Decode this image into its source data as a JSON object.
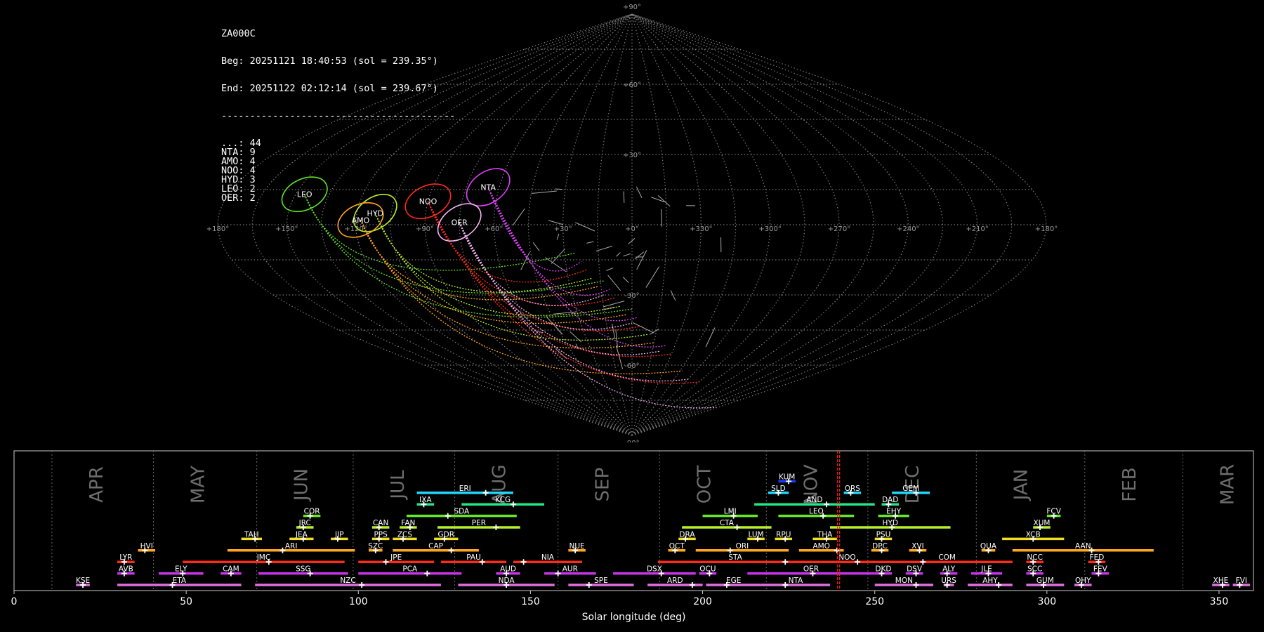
{
  "info": {
    "camera": "ZA000C",
    "beg": "Beg: 20251121 18:40:53 (sol = 239.35°)",
    "end": "End: 20251122 02:12:14 (sol = 239.67°)",
    "separator": "-----------------------------------------",
    "counts": [
      {
        "code": "...",
        "count": 44
      },
      {
        "code": "NTA",
        "count": 9
      },
      {
        "code": "AMO",
        "count": 4
      },
      {
        "code": "NOO",
        "count": 4
      },
      {
        "code": "HYD",
        "count": 3
      },
      {
        "code": "LEO",
        "count": 2
      },
      {
        "code": "OER",
        "count": 2
      }
    ]
  },
  "chart_data": [
    {
      "type": "scatter",
      "projection": "sinusoidal",
      "grid": true,
      "lon_tick_labels": [
        "+180°",
        "+150°",
        "+120°",
        "+90°",
        "+60°",
        "+30°",
        "+0°",
        "+330°",
        "+300°",
        "+270°",
        "+240°",
        "+210°",
        "+180°"
      ],
      "lat_tick_labels": [
        "+90°",
        "+60°",
        "+30°",
        "-30°",
        "-60°",
        "-90°"
      ],
      "radiants": [
        {
          "name": "LEO",
          "lon": 146,
          "lat": 13,
          "color": "#5fe22a"
        },
        {
          "name": "NTA",
          "lon": 65,
          "lat": 16,
          "color": "#e040fb"
        },
        {
          "name": "NOO",
          "lon": 90,
          "lat": 10,
          "color": "#ff2a1a"
        },
        {
          "name": "HYD",
          "lon": 112,
          "lat": 5,
          "color": "#b8f02a"
        },
        {
          "name": "AMO",
          "lon": 118,
          "lat": 2,
          "color": "#ffa520"
        },
        {
          "name": "OER",
          "lon": 75,
          "lat": 1,
          "color": "#f4b4f4"
        }
      ],
      "sporadic_count": 44
    },
    {
      "type": "range",
      "xlabel": "Solar longitude (deg)",
      "xlim": [
        0,
        360
      ],
      "x_ticks": [
        0,
        50,
        100,
        150,
        200,
        250,
        300,
        350
      ],
      "current_sol": 239.5,
      "months": [
        {
          "label": "APR",
          "start": 11
        },
        {
          "label": "MAY",
          "start": 40.5
        },
        {
          "label": "JUN",
          "start": 70.5
        },
        {
          "label": "JUL",
          "start": 98.5
        },
        {
          "label": "AUG",
          "start": 128
        },
        {
          "label": "SEP",
          "start": 158
        },
        {
          "label": "OCT",
          "start": 187.5
        },
        {
          "label": "NOV",
          "start": 218.5
        },
        {
          "label": "DEC",
          "start": 248
        },
        {
          "label": "JAN",
          "start": 279.5
        },
        {
          "label": "FEB",
          "start": 311
        },
        {
          "label": "MAR",
          "start": 339.5
        }
      ],
      "showers": [
        {
          "name": "KUM",
          "start": 222,
          "end": 227,
          "peak": 225,
          "row": 10,
          "color": "#1a3cff"
        },
        {
          "name": "ERI",
          "start": 117,
          "end": 145,
          "peak": 137,
          "row": 9,
          "color": "#22d8ff"
        },
        {
          "name": "SLD",
          "start": 219,
          "end": 225,
          "peak": 222,
          "row": 9,
          "color": "#22d8ff"
        },
        {
          "name": "ORS",
          "start": 241,
          "end": 246,
          "peak": 243,
          "row": 9,
          "color": "#22d8ff"
        },
        {
          "name": "GEM",
          "start": 255,
          "end": 266,
          "peak": 262,
          "row": 9,
          "color": "#22d8ff"
        },
        {
          "name": "IXA",
          "start": 117,
          "end": 122,
          "peak": 119,
          "row": 8,
          "color": "#22e888"
        },
        {
          "name": "KCG",
          "start": 130,
          "end": 154,
          "peak": 145,
          "row": 8,
          "color": "#22e888"
        },
        {
          "name": "AND",
          "start": 215,
          "end": 250,
          "peak": 236,
          "row": 8,
          "color": "#22e888"
        },
        {
          "name": "DAD",
          "start": 252,
          "end": 257,
          "peak": 254,
          "row": 8,
          "color": "#22e888"
        },
        {
          "name": "COR",
          "start": 84,
          "end": 89,
          "peak": 86,
          "row": 7,
          "color": "#66e82a"
        },
        {
          "name": "SDA",
          "start": 114,
          "end": 146,
          "peak": 126,
          "row": 7,
          "color": "#66e82a"
        },
        {
          "name": "LMI",
          "start": 200,
          "end": 216,
          "peak": 209,
          "row": 7,
          "color": "#66e82a"
        },
        {
          "name": "LEO",
          "start": 222,
          "end": 244,
          "peak": 235,
          "row": 7,
          "color": "#66e82a"
        },
        {
          "name": "EHY",
          "start": 251,
          "end": 260,
          "peak": 256,
          "row": 7,
          "color": "#66e82a"
        },
        {
          "name": "FCV",
          "start": 300,
          "end": 304,
          "peak": 302,
          "row": 7,
          "color": "#66e82a"
        },
        {
          "name": "JRC",
          "start": 82,
          "end": 87,
          "peak": 84,
          "row": 6,
          "color": "#b8f02a"
        },
        {
          "name": "CAN",
          "start": 104,
          "end": 109,
          "peak": 106,
          "row": 6,
          "color": "#b8f02a"
        },
        {
          "name": "FAN",
          "start": 112,
          "end": 117,
          "peak": 115,
          "row": 6,
          "color": "#b8f02a"
        },
        {
          "name": "PER",
          "start": 123,
          "end": 147,
          "peak": 140,
          "row": 6,
          "color": "#b8f02a"
        },
        {
          "name": "CTA",
          "start": 194,
          "end": 220,
          "peak": 210,
          "row": 6,
          "color": "#b8f02a"
        },
        {
          "name": "HYD",
          "start": 237,
          "end": 272,
          "peak": 255,
          "row": 6,
          "color": "#b8f02a"
        },
        {
          "name": "XUM",
          "start": 296,
          "end": 301,
          "peak": 298,
          "row": 6,
          "color": "#b8f02a"
        },
        {
          "name": "TAH",
          "start": 66,
          "end": 72,
          "peak": 70,
          "row": 5,
          "color": "#f0e020"
        },
        {
          "name": "JEA",
          "start": 80,
          "end": 87,
          "peak": 84,
          "row": 5,
          "color": "#f0e020"
        },
        {
          "name": "JIP",
          "start": 92,
          "end": 97,
          "peak": 94,
          "row": 5,
          "color": "#f0e020"
        },
        {
          "name": "PPS",
          "start": 104,
          "end": 109,
          "peak": 106,
          "row": 5,
          "color": "#f0e020"
        },
        {
          "name": "ZCS",
          "start": 110,
          "end": 117,
          "peak": 113,
          "row": 5,
          "color": "#f0e020"
        },
        {
          "name": "GDR",
          "start": 122,
          "end": 129,
          "peak": 125,
          "row": 5,
          "color": "#f0e020"
        },
        {
          "name": "DRA",
          "start": 193,
          "end": 198,
          "peak": 195,
          "row": 5,
          "color": "#f0e020"
        },
        {
          "name": "LUM",
          "start": 213,
          "end": 218,
          "peak": 216,
          "row": 5,
          "color": "#f0e020"
        },
        {
          "name": "RPU",
          "start": 221,
          "end": 226,
          "peak": 224,
          "row": 5,
          "color": "#f0e020"
        },
        {
          "name": "THA",
          "start": 232,
          "end": 239,
          "peak": 236,
          "row": 5,
          "color": "#f0e020"
        },
        {
          "name": "PSU",
          "start": 250,
          "end": 255,
          "peak": 252,
          "row": 5,
          "color": "#f0e020"
        },
        {
          "name": "XCB",
          "start": 287,
          "end": 305,
          "peak": 296,
          "row": 5,
          "color": "#f0e020"
        },
        {
          "name": "HVI",
          "start": 36,
          "end": 41,
          "peak": 38,
          "row": 4,
          "color": "#ffa520"
        },
        {
          "name": "ARI",
          "start": 62,
          "end": 99,
          "peak": 78,
          "row": 4,
          "color": "#ffa520"
        },
        {
          "name": "SZC",
          "start": 103,
          "end": 107,
          "peak": 105,
          "row": 4,
          "color": "#ffa520"
        },
        {
          "name": "CAP",
          "start": 110,
          "end": 135,
          "peak": 127,
          "row": 4,
          "color": "#ffa520"
        },
        {
          "name": "NUE",
          "start": 161,
          "end": 166,
          "peak": 163,
          "row": 4,
          "color": "#ffa520"
        },
        {
          "name": "OCT",
          "start": 190,
          "end": 195,
          "peak": 192,
          "row": 4,
          "color": "#ffa520"
        },
        {
          "name": "ORI",
          "start": 198,
          "end": 225,
          "peak": 208,
          "row": 4,
          "color": "#ffa520"
        },
        {
          "name": "AMO",
          "start": 228,
          "end": 241,
          "peak": 239,
          "row": 4,
          "color": "#ffa520"
        },
        {
          "name": "DPC",
          "start": 249,
          "end": 254,
          "peak": 252,
          "row": 4,
          "color": "#ffa520"
        },
        {
          "name": "XVI",
          "start": 260,
          "end": 265,
          "peak": 263,
          "row": 4,
          "color": "#ffa520"
        },
        {
          "name": "QUA",
          "start": 281,
          "end": 285,
          "peak": 283,
          "row": 4,
          "color": "#ffa520"
        },
        {
          "name": "AAN",
          "start": 290,
          "end": 331,
          "peak": 313,
          "row": 4,
          "color": "#ffa520"
        },
        {
          "name": "LYR",
          "start": 30,
          "end": 35,
          "peak": 32,
          "row": 3,
          "color": "#ff2a1a"
        },
        {
          "name": "JMC",
          "start": 49,
          "end": 96,
          "peak": 74,
          "row": 3,
          "color": "#ff2a1a"
        },
        {
          "name": "JPE",
          "start": 100,
          "end": 122,
          "peak": 108,
          "row": 3,
          "color": "#ff2a1a"
        },
        {
          "name": "PAU",
          "start": 124,
          "end": 143,
          "peak": 136,
          "row": 3,
          "color": "#ff2a1a"
        },
        {
          "name": "NIA",
          "start": 145,
          "end": 165,
          "peak": 148,
          "row": 3,
          "color": "#ff2a1a"
        },
        {
          "name": "STA",
          "start": 187,
          "end": 232,
          "peak": 224,
          "row": 3,
          "color": "#ff2a1a"
        },
        {
          "name": "NOO",
          "start": 232,
          "end": 252,
          "peak": 245,
          "row": 3,
          "color": "#ff2a1a"
        },
        {
          "name": "COM",
          "start": 252,
          "end": 290,
          "peak": 264,
          "row": 3,
          "color": "#ff2a1a"
        },
        {
          "name": "NCC",
          "start": 294,
          "end": 299,
          "peak": 296,
          "row": 3,
          "color": "#ff2a1a"
        },
        {
          "name": "FED",
          "start": 312,
          "end": 317,
          "peak": 315,
          "row": 3,
          "color": "#ff2a1a"
        },
        {
          "name": "AVB",
          "start": 30,
          "end": 35,
          "peak": 32,
          "row": 2,
          "color": "#cc33ee"
        },
        {
          "name": "ELY",
          "start": 42,
          "end": 55,
          "peak": 49,
          "row": 2,
          "color": "#cc33ee"
        },
        {
          "name": "CAM",
          "start": 60,
          "end": 66,
          "peak": 63,
          "row": 2,
          "color": "#cc33ee"
        },
        {
          "name": "SSG",
          "start": 71,
          "end": 97,
          "peak": 86,
          "row": 2,
          "color": "#cc33ee"
        },
        {
          "name": "PCA",
          "start": 100,
          "end": 130,
          "peak": 120,
          "row": 2,
          "color": "#cc33ee"
        },
        {
          "name": "AUD",
          "start": 140,
          "end": 147,
          "peak": 143,
          "row": 2,
          "color": "#cc33ee"
        },
        {
          "name": "AUR",
          "start": 154,
          "end": 169,
          "peak": 158,
          "row": 2,
          "color": "#cc33ee"
        },
        {
          "name": "DSX",
          "start": 174,
          "end": 198,
          "peak": 188,
          "row": 2,
          "color": "#cc33ee"
        },
        {
          "name": "OCU",
          "start": 199,
          "end": 204,
          "peak": 202,
          "row": 2,
          "color": "#cc33ee"
        },
        {
          "name": "OER",
          "start": 213,
          "end": 250,
          "peak": 232,
          "row": 2,
          "color": "#cc33ee"
        },
        {
          "name": "DKD",
          "start": 250,
          "end": 255,
          "peak": 252,
          "row": 2,
          "color": "#cc33ee"
        },
        {
          "name": "DSV",
          "start": 259,
          "end": 264,
          "peak": 262,
          "row": 2,
          "color": "#cc33ee"
        },
        {
          "name": "ALY",
          "start": 269,
          "end": 274,
          "peak": 271,
          "row": 2,
          "color": "#cc33ee"
        },
        {
          "name": "JLE",
          "start": 278,
          "end": 287,
          "peak": 283,
          "row": 2,
          "color": "#cc33ee"
        },
        {
          "name": "SCC",
          "start": 294,
          "end": 299,
          "peak": 296,
          "row": 2,
          "color": "#cc33ee"
        },
        {
          "name": "FEV",
          "start": 313,
          "end": 318,
          "peak": 315,
          "row": 2,
          "color": "#cc33ee"
        },
        {
          "name": "KSE",
          "start": 18,
          "end": 22,
          "peak": 20,
          "row": 1,
          "color": "#e070e0"
        },
        {
          "name": "ETA",
          "start": 30,
          "end": 66,
          "peak": 46,
          "row": 1,
          "color": "#e070e0"
        },
        {
          "name": "NZC",
          "start": 70,
          "end": 124,
          "peak": 101,
          "row": 1,
          "color": "#e070e0"
        },
        {
          "name": "NDA",
          "start": 129,
          "end": 157,
          "peak": 143,
          "row": 1,
          "color": "#e070e0"
        },
        {
          "name": "SPE",
          "start": 161,
          "end": 180,
          "peak": 167,
          "row": 1,
          "color": "#e070e0"
        },
        {
          "name": "ARD",
          "start": 184,
          "end": 200,
          "peak": 197,
          "row": 1,
          "color": "#e070e0"
        },
        {
          "name": "EGE",
          "start": 201,
          "end": 217,
          "peak": 207,
          "row": 1,
          "color": "#e070e0"
        },
        {
          "name": "NTA",
          "start": 217,
          "end": 237,
          "peak": 224,
          "row": 1,
          "color": "#e070e0"
        },
        {
          "name": "MON",
          "start": 250,
          "end": 267,
          "peak": 262,
          "row": 1,
          "color": "#e070e0"
        },
        {
          "name": "URS",
          "start": 270,
          "end": 273,
          "peak": 271,
          "row": 1,
          "color": "#e070e0"
        },
        {
          "name": "AHY",
          "start": 277,
          "end": 290,
          "peak": 286,
          "row": 1,
          "color": "#e070e0"
        },
        {
          "name": "GUM",
          "start": 294,
          "end": 305,
          "peak": 299,
          "row": 1,
          "color": "#e070e0"
        },
        {
          "name": "OHY",
          "start": 308,
          "end": 313,
          "peak": 310,
          "row": 1,
          "color": "#e070e0"
        },
        {
          "name": "XHE",
          "start": 348,
          "end": 353,
          "peak": 351,
          "row": 1,
          "color": "#e070e0"
        },
        {
          "name": "FVI",
          "start": 354,
          "end": 359,
          "peak": 356,
          "row": 1,
          "color": "#e070e0"
        }
      ]
    }
  ]
}
